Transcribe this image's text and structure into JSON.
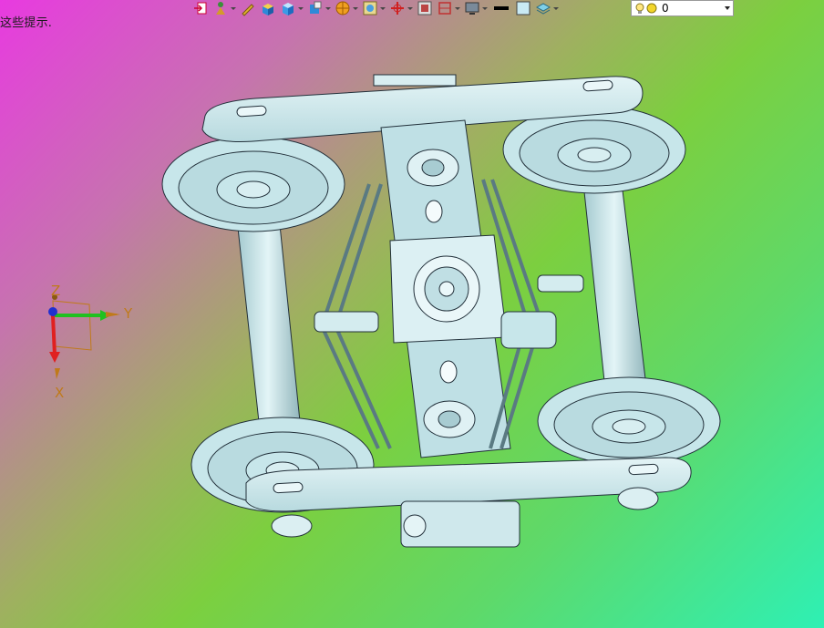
{
  "prompt": {
    "hint_text": "这些提示."
  },
  "toolbar": {
    "buttons": [
      {
        "name": "exit-sketch-icon",
        "dropdown": false
      },
      {
        "name": "snap-icon",
        "dropdown": true
      },
      {
        "name": "pencil-icon",
        "dropdown": false
      },
      {
        "name": "shaded-box-icon",
        "dropdown": false
      },
      {
        "name": "render-style-icon",
        "dropdown": true
      },
      {
        "name": "view-orient-icon",
        "dropdown": true
      },
      {
        "name": "section-view-icon",
        "dropdown": true
      },
      {
        "name": "zoom-fit-icon",
        "dropdown": true
      },
      {
        "name": "wcs-icon",
        "dropdown": true
      },
      {
        "name": "zoom-window-icon",
        "dropdown": false
      },
      {
        "name": "clip-icon",
        "dropdown": true
      },
      {
        "name": "display-icon",
        "dropdown": true
      },
      {
        "name": "line-color-icon",
        "dropdown": false
      },
      {
        "name": "fill-color-icon",
        "dropdown": false
      },
      {
        "name": "layer-icon",
        "dropdown": true
      }
    ],
    "layer": {
      "value": "0"
    }
  },
  "triad": {
    "x_label": "X",
    "y_label": "Y",
    "z_label": "Z"
  },
  "colors": {
    "part": "#c7e6ea",
    "edge": "#22303a",
    "x_axis": "#e02020",
    "y_axis": "#20c020",
    "z_axis": "#2030d0"
  }
}
